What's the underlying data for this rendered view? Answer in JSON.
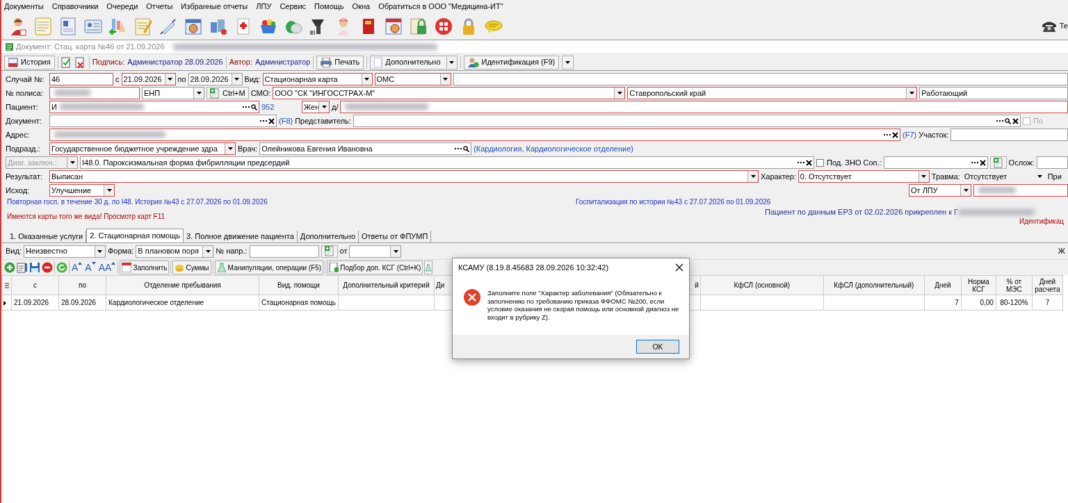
{
  "menu": [
    "Документы",
    "Справочники",
    "Очереди",
    "Отчеты",
    "Избранные отчеты",
    "ЛПУ",
    "Сервис",
    "Помощь",
    "Окна",
    "Обратиться в ООО \"Медицина-ИТ\""
  ],
  "phone_label": "Те",
  "document_title": "Документ: Стац. карта №46 от 21.09.2026",
  "action_bar": {
    "history": "История",
    "signature_label": "Подпись:",
    "signature": "Администратор 28.09.2026",
    "author_label": "Автор:",
    "author": "Администратор",
    "print": "Печать",
    "more": "Дополнительно",
    "identify": "Идентификация (F9)"
  },
  "form_rows": [
    [
      {
        "kind": "label",
        "text": "Случай №:"
      },
      {
        "kind": "field",
        "value": "46",
        "required": true
      },
      {
        "kind": "label",
        "text": "с"
      },
      {
        "kind": "combo",
        "value": "21.09.2026",
        "required": true
      },
      {
        "kind": "label",
        "text": "по"
      },
      {
        "kind": "combo",
        "value": "28.09.2026",
        "required": false
      },
      {
        "kind": "label",
        "text": "Вид:"
      },
      {
        "kind": "combo",
        "value": "Стационарная карта",
        "required": true
      },
      {
        "kind": "combo",
        "value": "ОМС",
        "required": true
      },
      {
        "kind": "field",
        "required": false
      }
    ],
    [
      {
        "kind": "label",
        "text": "№ полиса:"
      },
      {
        "kind": "field",
        "required": true,
        "redacted": true
      },
      {
        "kind": "combo",
        "value": "ЕНП",
        "required": false
      },
      {
        "kind": "icon-button",
        "text": "Ctrl+M"
      },
      {
        "kind": "label",
        "text": "СМО:"
      },
      {
        "kind": "combo",
        "value": "ООО \"СК \"ИНГОССТРАХ-М\"",
        "required": true
      },
      {
        "kind": "combo",
        "value": "Ставропольский край",
        "required": true
      },
      {
        "kind": "field",
        "value": "Работающий",
        "required": false
      }
    ],
    [
      {
        "kind": "label",
        "text": "Пациент:"
      },
      {
        "kind": "picker",
        "value": "И",
        "required": true,
        "redacted": true
      },
      {
        "kind": "link",
        "text": "952"
      },
      {
        "kind": "combo",
        "value": "Жен",
        "required": true
      },
      {
        "kind": "label",
        "text": "д/"
      },
      {
        "kind": "field",
        "required": true,
        "redacted": true
      }
    ],
    [
      {
        "kind": "label",
        "text": "Документ:"
      },
      {
        "kind": "clearable",
        "required": false
      },
      {
        "kind": "link",
        "text": "(F8)"
      },
      {
        "kind": "label",
        "text": "Представитель:"
      },
      {
        "kind": "finder",
        "required": false
      },
      {
        "kind": "checkbox",
        "label": "По",
        "checked": false,
        "disabled": true
      }
    ],
    [
      {
        "kind": "label",
        "text": "Адрес:"
      },
      {
        "kind": "clearable",
        "required": true,
        "redacted": true
      },
      {
        "kind": "link",
        "text": "(F7)"
      },
      {
        "kind": "label",
        "text": "Участок:"
      },
      {
        "kind": "field",
        "required": false
      }
    ],
    [
      {
        "kind": "label",
        "text": "Подразд.:"
      },
      {
        "kind": "combo",
        "value": "Государственное бюджетное учреждение здра",
        "required": true
      },
      {
        "kind": "label",
        "text": "Врач:"
      },
      {
        "kind": "picker",
        "value": "Олейникова Евгения Ивановна",
        "required": false
      },
      {
        "kind": "link",
        "text": "(Кардиология, Кардиологическое отделение)"
      }
    ],
    [
      {
        "kind": "combo",
        "value": "Диаг. заключ.:",
        "required": false,
        "disabled": true
      },
      {
        "kind": "clearable",
        "value": "I48.0. Пароксизмальная форма фибрилляции предсердий",
        "required": false
      },
      {
        "kind": "checkbox",
        "label": "Под. ЗНО",
        "checked": false,
        "disabled": false
      },
      {
        "kind": "label",
        "text": "Соп.:"
      },
      {
        "kind": "clearable",
        "required": false
      },
      {
        "kind": "icon-button"
      },
      {
        "kind": "label",
        "text": "Ослож:"
      },
      {
        "kind": "field",
        "required": false
      }
    ],
    [
      {
        "kind": "label",
        "text": "Результат:"
      },
      {
        "kind": "combo",
        "value": "Выписан",
        "required": true
      },
      {
        "kind": "label",
        "text": "Характер:"
      },
      {
        "kind": "combo",
        "value": "0. Отсутствует",
        "required": true
      },
      {
        "kind": "label",
        "text": "Травма:"
      },
      {
        "kind": "combo",
        "value": "Отсутствует",
        "required": false,
        "flat": true
      },
      {
        "kind": "label",
        "text": "При"
      }
    ],
    [
      {
        "kind": "label",
        "text": "Исход:"
      },
      {
        "kind": "combo",
        "value": "Улучшение",
        "required": true
      },
      {
        "kind": "combo",
        "value": "От ЛПУ",
        "required": true
      },
      {
        "kind": "field",
        "required": true,
        "redacted": true
      }
    ]
  ],
  "notes": [
    {
      "text": "Повторная госп. в течение 30 д. по I48. История №43 с 27.07.2026 по 01.09.2026",
      "kind": "info"
    },
    {
      "text": "Имеются карты того же вида! Просмотр карт F11",
      "kind": "warning"
    },
    {
      "text": "Госпитализация по истории №43 с 27.07.2026 по 01.09.2026",
      "kind": "info"
    },
    {
      "text": "Пациент по данным ЕРЗ от 02.02.2026 прикреплен к Г",
      "kind": "status",
      "redacted": true
    },
    {
      "text": "Идентификац",
      "kind": "warning"
    }
  ],
  "tabs": [
    {
      "label": "1. Оказанные услуги",
      "selected": false
    },
    {
      "label": "2. Стационарная помощь",
      "selected": true
    },
    {
      "label": "3. Полное движение пациента",
      "selected": false
    },
    {
      "label": "Дополнительно",
      "selected": false
    },
    {
      "label": "Ответы от ФПУМП",
      "selected": false
    }
  ],
  "filter_row": [
    {
      "kind": "label",
      "text": "Вид:"
    },
    {
      "kind": "combo",
      "value": "Неизвестно",
      "required": false
    },
    {
      "kind": "label",
      "text": "Форма:"
    },
    {
      "kind": "combo",
      "value": "В плановом поря",
      "required": false
    },
    {
      "kind": "label",
      "text": "№ напр.:"
    },
    {
      "kind": "field",
      "required": false
    },
    {
      "kind": "icon-button"
    },
    {
      "kind": "label",
      "text": "от"
    },
    {
      "kind": "combo",
      "required": false
    },
    {
      "kind": "label",
      "text": "Ж"
    }
  ],
  "grid_toolbar": [
    {
      "kind": "font",
      "text": "A"
    },
    {
      "kind": "font",
      "text": "A"
    },
    {
      "kind": "font",
      "text": "AA"
    },
    {
      "kind": "button",
      "text": "Заполнить"
    },
    {
      "kind": "button",
      "text": "Суммы"
    },
    {
      "kind": "button",
      "text": "Манипуляции, операции (F5)"
    },
    {
      "kind": "button",
      "text": "Подбор доп. КСГ (Ctrl+K)"
    }
  ],
  "table": {
    "columns": [
      "с",
      "по",
      "Отделение пребывания",
      "Вид. помощи",
      "Дополнительный критерий",
      "Ди",
      "й",
      "КфСЛ (основной)",
      "КфСЛ (дополнительный)",
      "Дней",
      "Норма КСГ",
      "% от МЭС",
      "Дней расчета"
    ],
    "rows": [
      {
        "selected": true,
        "cells": [
          "21.09.2026",
          "28.09.2026",
          "Кардиологическое отделение",
          "Стационарная помощь",
          null,
          null,
          null,
          null,
          null,
          "7",
          "0,00",
          "80-120%",
          "7"
        ]
      }
    ]
  },
  "dialog": {
    "title": "КСАМУ (8.19.8.45683 28.09.2026 10:32:42)",
    "message": "Заполните поле \"Характер заболевания\" (Обязательно к заполнению по требованию приказа ФФОМС №200, если условие оказания не скорая помощь или основной диагноз не входит в рубрику Z).",
    "button": "OK"
  }
}
